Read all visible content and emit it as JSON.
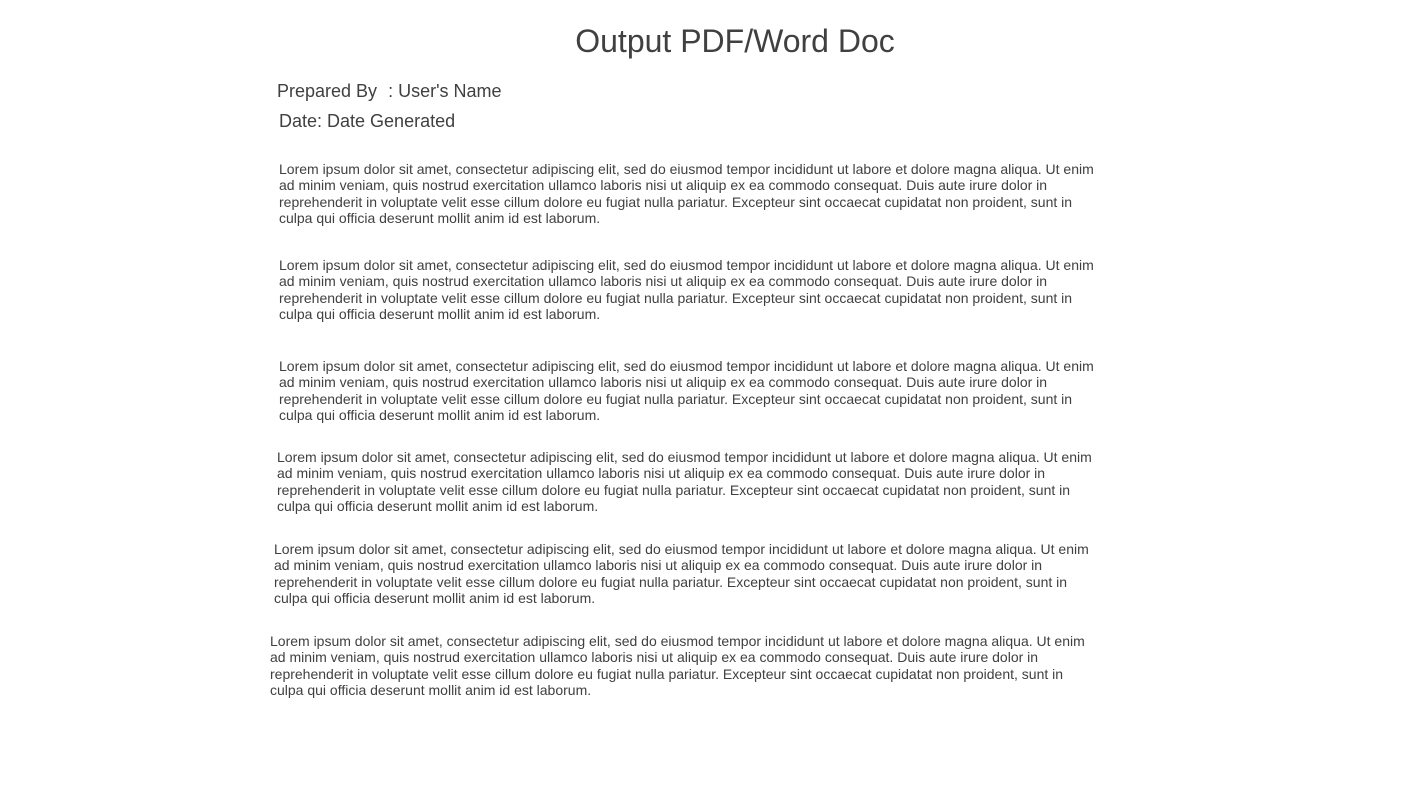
{
  "document": {
    "title": "Output PDF/Word Doc",
    "prepared_by_label": "Prepared By",
    "prepared_by_value": ": User's Name",
    "date_line": "Date: Date Generated",
    "paragraphs": [
      "Lorem ipsum dolor sit amet, consectetur adipiscing elit, sed do eiusmod tempor incididunt ut labore et dolore magna aliqua. Ut enim ad minim veniam, quis nostrud exercitation ullamco laboris nisi ut aliquip ex ea commodo consequat. Duis aute irure dolor in reprehenderit in voluptate velit esse cillum dolore eu fugiat nulla pariatur. Excepteur sint occaecat cupidatat non proident, sunt in culpa qui officia deserunt mollit anim id est laborum.",
      "Lorem ipsum dolor sit amet, consectetur adipiscing elit, sed do eiusmod tempor incididunt ut labore et dolore magna aliqua. Ut enim ad minim veniam, quis nostrud exercitation ullamco laboris nisi ut aliquip ex ea commodo consequat. Duis aute irure dolor in reprehenderit in voluptate velit esse cillum dolore eu fugiat nulla pariatur. Excepteur sint occaecat cupidatat non proident, sunt in culpa qui officia deserunt mollit anim id est laborum.",
      "Lorem ipsum dolor sit amet, consectetur adipiscing elit, sed do eiusmod tempor incididunt ut labore et dolore magna aliqua. Ut enim ad minim veniam, quis nostrud exercitation ullamco laboris nisi ut aliquip ex ea commodo consequat. Duis aute irure dolor in reprehenderit in voluptate velit esse cillum dolore eu fugiat nulla pariatur. Excepteur sint occaecat cupidatat non proident, sunt in culpa qui officia deserunt mollit anim id est laborum.",
      "Lorem ipsum dolor sit amet, consectetur adipiscing elit, sed do eiusmod tempor incididunt ut labore et dolore magna aliqua. Ut enim ad minim veniam, quis nostrud exercitation ullamco laboris nisi ut aliquip ex ea commodo consequat. Duis aute irure dolor in reprehenderit in voluptate velit esse cillum dolore eu fugiat nulla pariatur. Excepteur sint occaecat cupidatat non proident, sunt in culpa qui officia deserunt mollit anim id est laborum.",
      "Lorem ipsum dolor sit amet, consectetur adipiscing elit, sed do eiusmod tempor incididunt ut labore et dolore magna aliqua. Ut enim ad minim veniam, quis nostrud exercitation ullamco laboris nisi ut aliquip ex ea commodo consequat. Duis aute irure dolor in reprehenderit in voluptate velit esse cillum dolore eu fugiat nulla pariatur. Excepteur sint occaecat cupidatat non proident, sunt in culpa qui officia deserunt mollit anim id est laborum.",
      "Lorem ipsum dolor sit amet, consectetur adipiscing elit, sed do eiusmod tempor incididunt ut labore et dolore magna aliqua. Ut enim ad minim veniam, quis nostrud exercitation ullamco laboris nisi ut aliquip ex ea commodo consequat. Duis aute irure dolor in reprehenderit in voluptate velit esse cillum dolore eu fugiat nulla pariatur. Excepteur sint occaecat cupidatat non proident, sunt in culpa qui officia deserunt mollit anim id est laborum."
    ]
  },
  "colors": {
    "text": "#404040",
    "background": "#ffffff"
  }
}
